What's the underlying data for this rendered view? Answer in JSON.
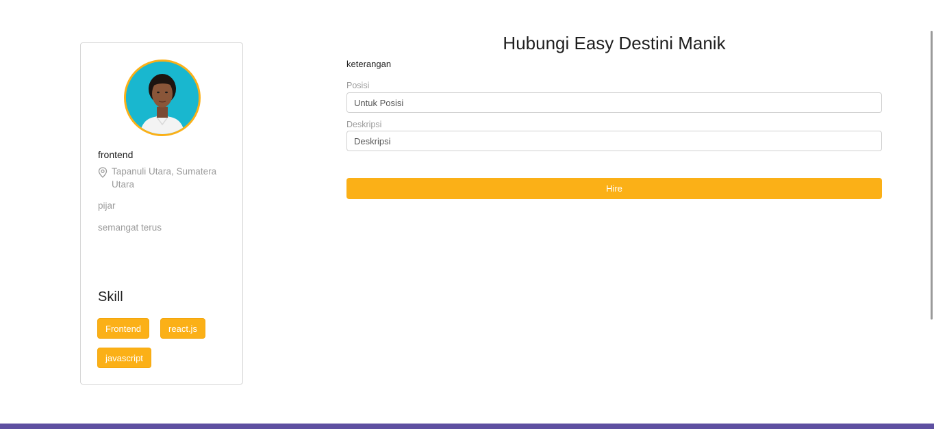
{
  "profile": {
    "job_title": "frontend",
    "location": "Tapanuli Utara, Sumatera Utara",
    "company": "pijar",
    "bio": "semangat terus",
    "skill_heading": "Skill",
    "skills": [
      "Frontend",
      "react.js",
      "javascript"
    ],
    "location_icon": "location-pin-icon"
  },
  "form": {
    "title": "Hubungi Easy Destini Manik",
    "subtitle": "keterangan",
    "position_label": "Posisi",
    "position_placeholder": "Untuk Posisi",
    "position_value": "",
    "description_label": "Deskripsi",
    "description_placeholder": "Deskripsi",
    "description_value": "",
    "submit_label": "Hire"
  },
  "colors": {
    "accent": "#fbb017",
    "footer": "#5e50a1",
    "avatar_background": "#19b7cf"
  }
}
